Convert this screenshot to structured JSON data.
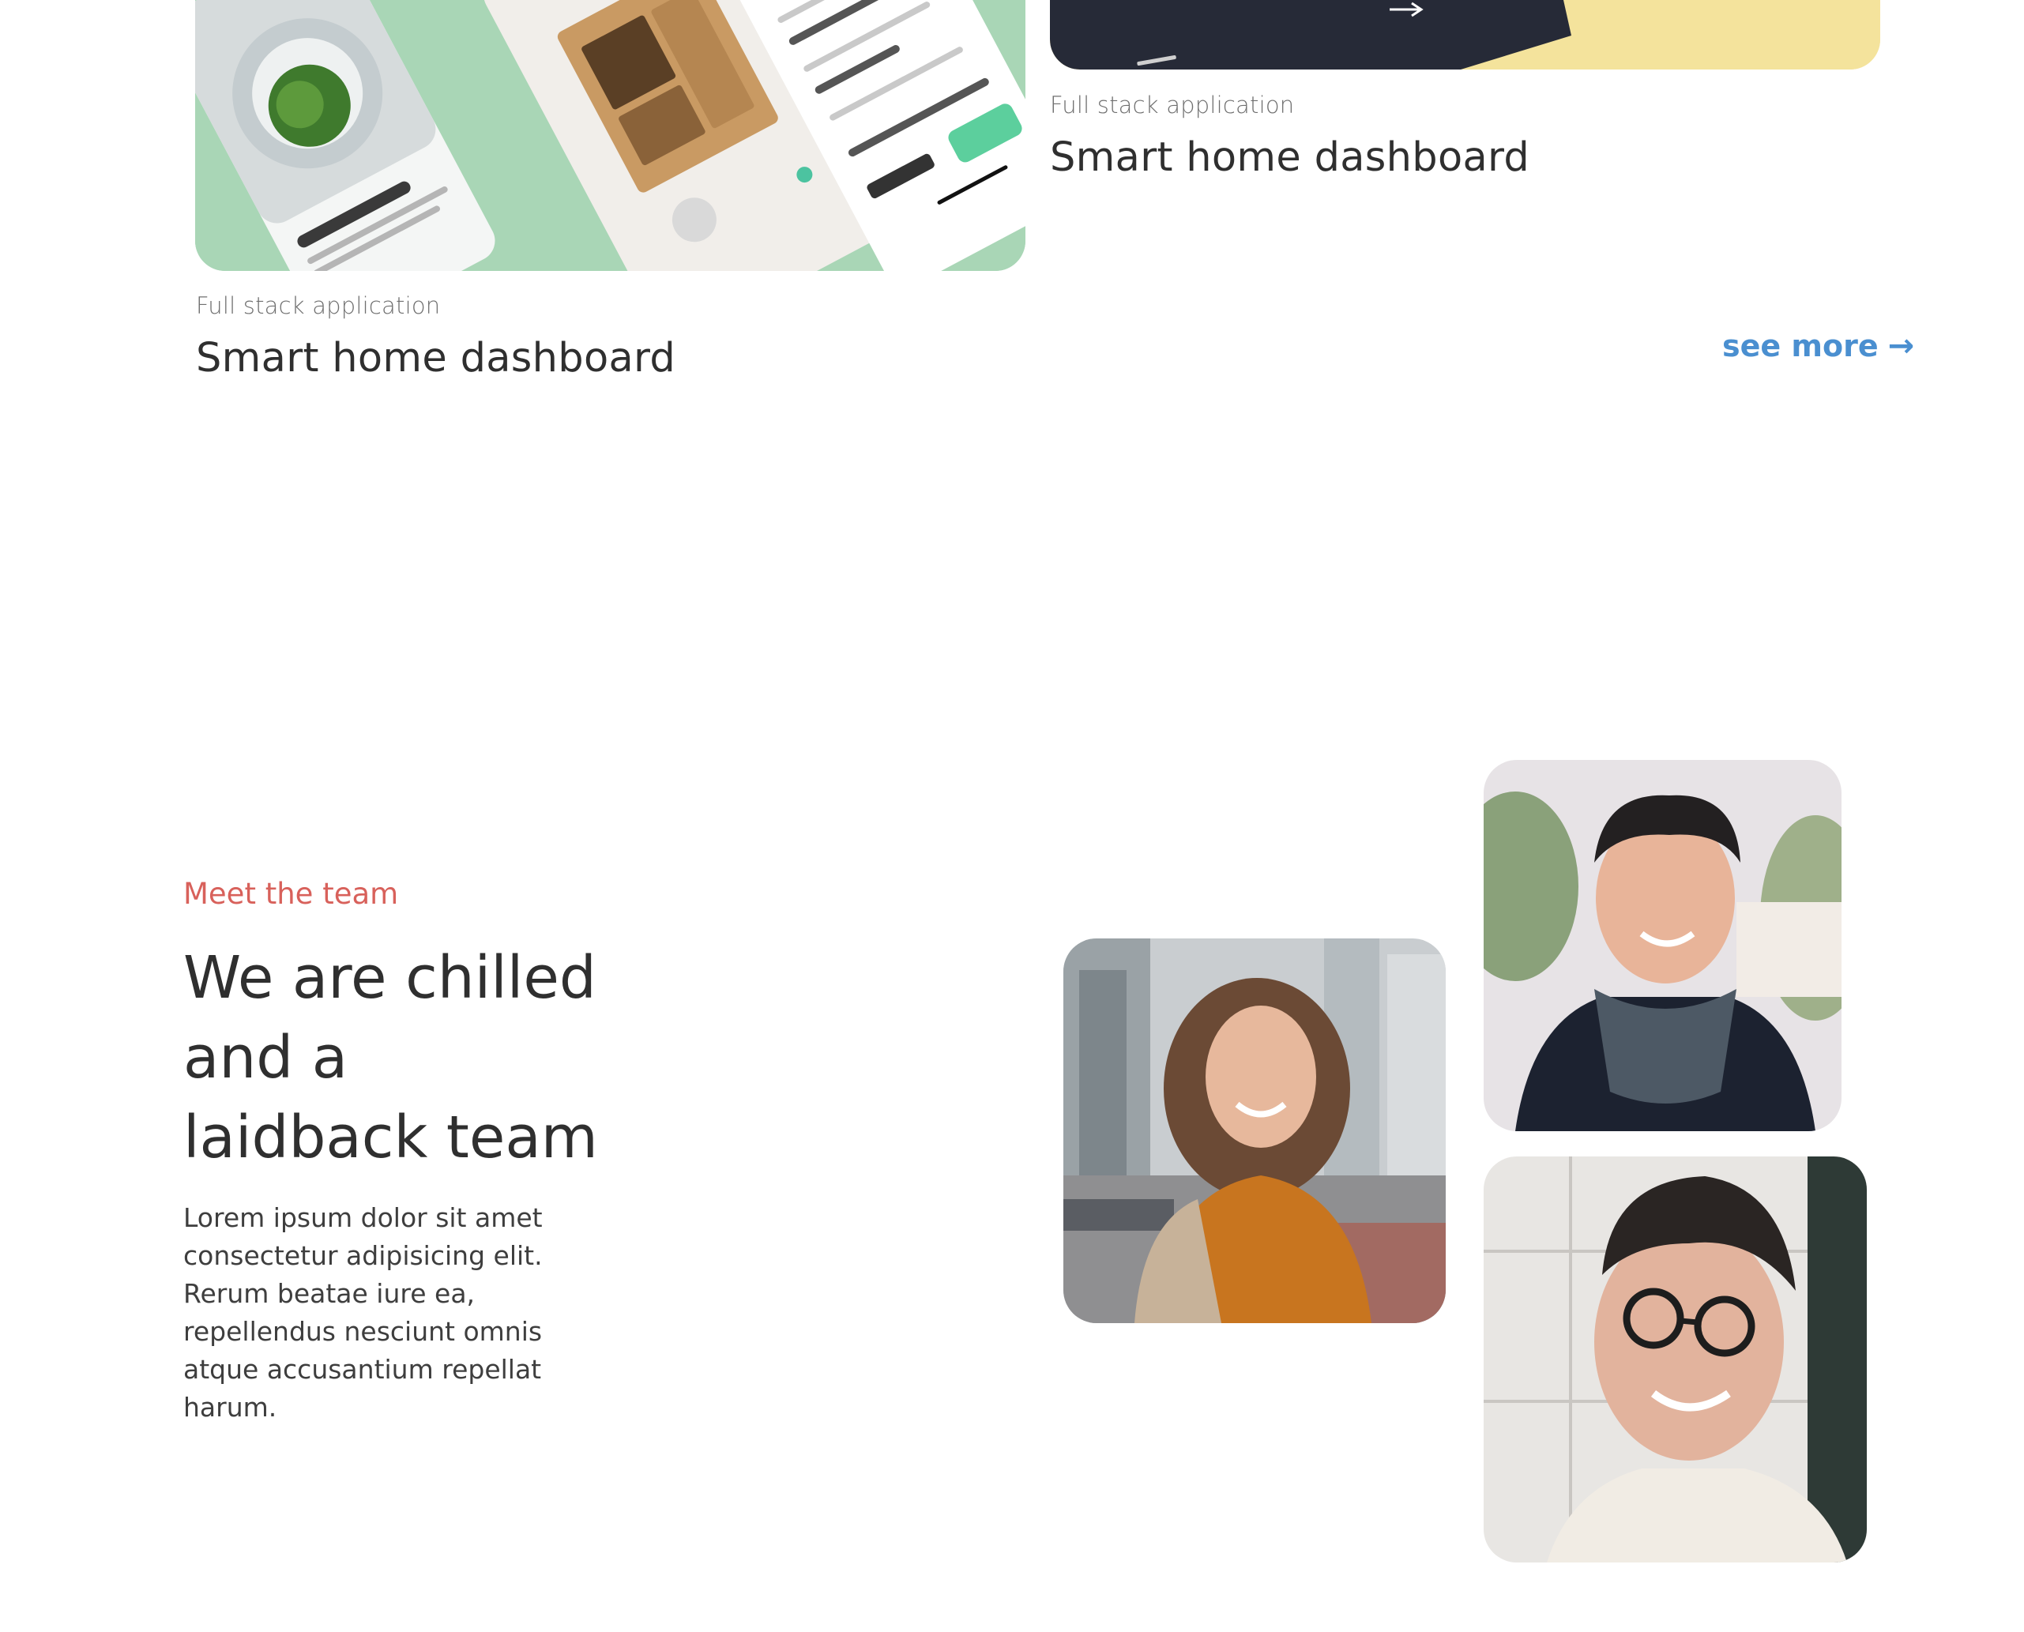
{
  "projects": [
    {
      "category": "Full stack application",
      "title": "Smart home dashboard",
      "image_icon": "fashion-app-mockup"
    },
    {
      "category": "Full stack application",
      "title": "Smart home dashboard",
      "image_icon": "dark-card-mockup"
    }
  ],
  "see_more": {
    "label": "see more",
    "arrow": "→"
  },
  "team": {
    "eyebrow": "Meet the team",
    "heading_lines": [
      "We are chilled",
      "and a",
      "laidback team"
    ],
    "body": "Lorem ipsum dolor sit amet consectetur adipisicing elit. Rerum beatae iure ea, repellendus nesciunt omnis atque accusantium repellat harum."
  },
  "colors": {
    "accent_red": "#d8615b",
    "link_blue": "#4a8fd0",
    "card_green": "#a9d6b6",
    "card_yellow": "#f4e39c",
    "card_dark": "#262a37",
    "heading": "#2f2f2f",
    "muted": "#6f6f6f"
  }
}
